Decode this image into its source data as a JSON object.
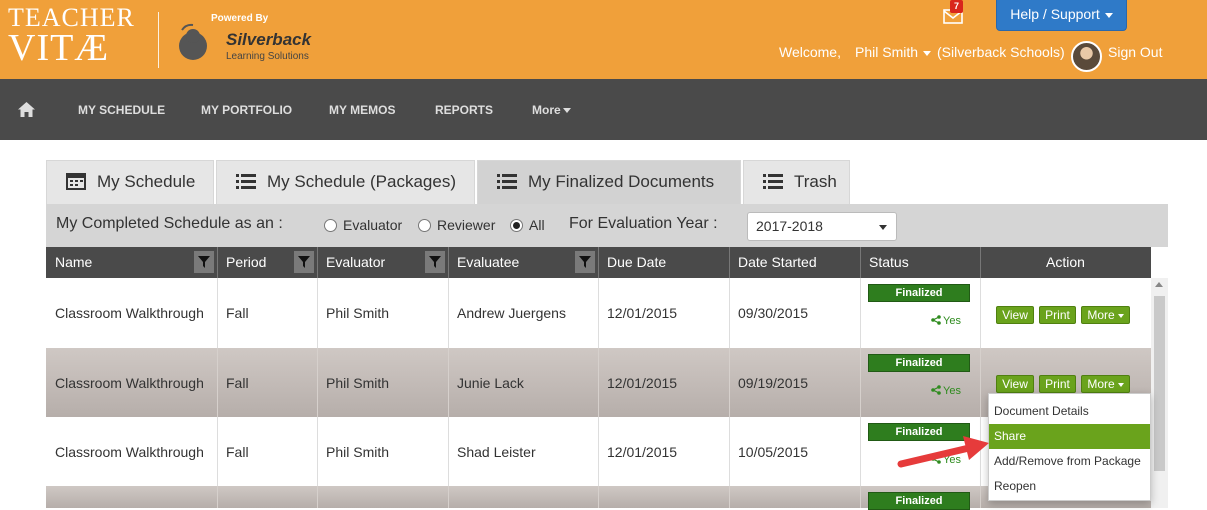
{
  "header": {
    "logo_line1": "TEACHER",
    "logo_line2": "VITÆ",
    "powered_by": "Powered By",
    "partner_name": "Silverback",
    "partner_sub": "Learning Solutions",
    "mail_count": "7",
    "help_label": "Help / Support",
    "welcome": "Welcome,",
    "user_name": "Phil Smith",
    "org": "(Silverback Schools)",
    "sign_out": "Sign Out"
  },
  "nav": {
    "items": [
      "MY SCHEDULE",
      "MY PORTFOLIO",
      "MY MEMOS",
      "REPORTS"
    ],
    "more": "More"
  },
  "tabs": [
    "My Schedule",
    "My Schedule (Packages)",
    "My Finalized Documents",
    "Trash"
  ],
  "filter": {
    "label": "My Completed Schedule as an :",
    "options": [
      "Evaluator",
      "Reviewer",
      "All"
    ],
    "selected": "All",
    "year_label": "For Evaluation Year :",
    "year_value": "2017-2018"
  },
  "table": {
    "columns": [
      "Name",
      "Period",
      "Evaluator",
      "Evaluatee",
      "Due Date",
      "Date Started",
      "Status",
      "Action"
    ],
    "rows": [
      {
        "name": "Classroom Walkthrough",
        "period": "Fall",
        "evaluator": "Phil Smith",
        "evaluatee": "Andrew Juergens",
        "due": "12/01/2015",
        "started": "09/30/2015",
        "status": "Finalized",
        "shared": "Yes"
      },
      {
        "name": "Classroom Walkthrough",
        "period": "Fall",
        "evaluator": "Phil Smith",
        "evaluatee": "Junie Lack",
        "due": "12/01/2015",
        "started": "09/19/2015",
        "status": "Finalized",
        "shared": "Yes"
      },
      {
        "name": "Classroom Walkthrough",
        "period": "Fall",
        "evaluator": "Phil Smith",
        "evaluatee": "Shad Leister",
        "due": "12/01/2015",
        "started": "10/05/2015",
        "status": "Finalized",
        "shared": "Yes"
      },
      {
        "status": "Finalized"
      }
    ],
    "actions": {
      "view": "View",
      "print": "Print",
      "more": "More"
    }
  },
  "more_menu": [
    "Document Details",
    "Share",
    "Add/Remove from Package",
    "Reopen"
  ],
  "colors": {
    "header_orange": "#f0a03a",
    "nav_gray": "#4a4a4a",
    "help_blue": "#2f7ac8",
    "status_green": "#2e7d1e",
    "button_green": "#6aa31c",
    "arrow_red": "#e63b3b"
  }
}
